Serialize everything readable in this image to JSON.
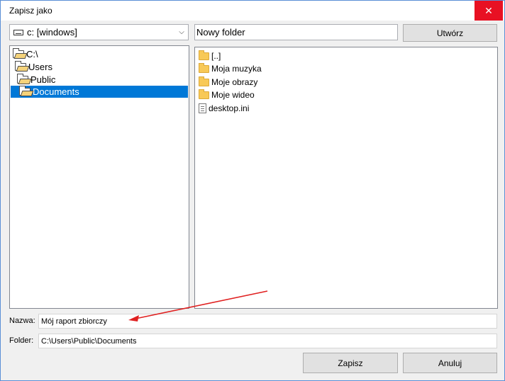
{
  "window": {
    "title": "Zapisz jako",
    "close_symbol": "✕"
  },
  "toolbar": {
    "drive_icon": "drive-icon",
    "drive_value": "c: [windows]",
    "drive_chevron": "⌵",
    "new_folder_value": "Nowy folder",
    "create_label": "Utwórz"
  },
  "tree": {
    "items": [
      {
        "label": "C:\\",
        "icon": "folder-open-icon"
      },
      {
        "label": "Users",
        "icon": "folder-open-icon"
      },
      {
        "label": "Public",
        "icon": "folder-open-icon"
      },
      {
        "label": "Documents",
        "icon": "folder-open-icon",
        "selected": true
      }
    ]
  },
  "files": {
    "items": [
      {
        "label": "[..]",
        "icon": "folder-icon"
      },
      {
        "label": "Moja muzyka",
        "icon": "folder-icon"
      },
      {
        "label": "Moje obrazy",
        "icon": "folder-icon"
      },
      {
        "label": "Moje wideo",
        "icon": "folder-icon"
      },
      {
        "label": "desktop.ini",
        "icon": "file-icon"
      }
    ]
  },
  "form": {
    "name_label": "Nazwa:",
    "name_value": "Mój raport zbiorczy",
    "folder_label": "Folder:",
    "folder_value": "C:\\Users\\Public\\Documents"
  },
  "buttons": {
    "save_label": "Zapisz",
    "cancel_label": "Anuluj"
  },
  "colors": {
    "selection": "#0078d7",
    "close_button": "#e81123",
    "annotation_arrow": "#e02020"
  }
}
